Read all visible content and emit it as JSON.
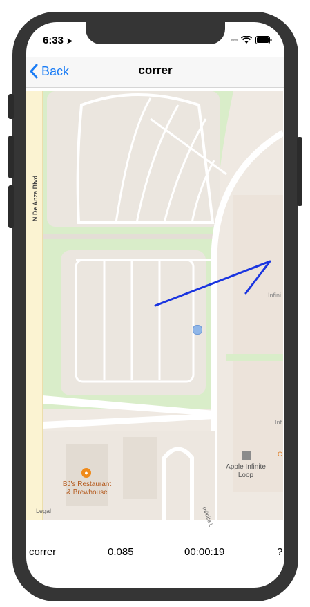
{
  "status": {
    "time": "6:33"
  },
  "nav": {
    "back_label": "Back",
    "title": "correr"
  },
  "map": {
    "labels": {
      "street": "N De Anza Blvd",
      "restaurant": "BJ's Restaurant & Brewhouse",
      "apple": "Apple Infinite Loop",
      "infinite_loop": "Infinite L",
      "infinite_cut1": "Infini",
      "infinite_cut2": "Inf",
      "orange_cut": "C",
      "legal": "Legal"
    },
    "colors": {
      "route": "#1a35e0",
      "park": "#d8ecc8",
      "building": "#efe7df",
      "road": "#ffffff"
    }
  },
  "row": {
    "name": "correr",
    "distance": "0.085",
    "duration": "00:00:19",
    "extra": "?"
  }
}
